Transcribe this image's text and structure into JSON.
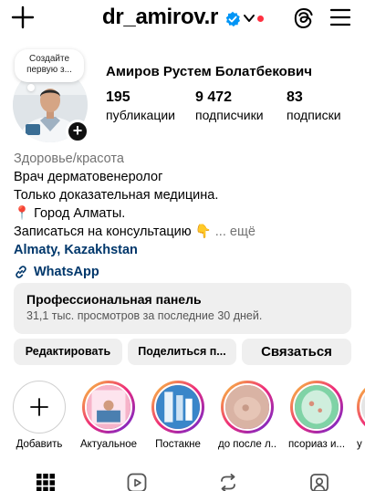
{
  "header": {
    "username": "dr_amirov.r",
    "has_unread_dot": true
  },
  "profile": {
    "note_line1": "Создайте",
    "note_line2": "первую з...",
    "full_name": "Амиров Рустем Болатбекович",
    "stats": [
      {
        "value": "195",
        "label": "публикации"
      },
      {
        "value": "9 472",
        "label": "подписчики"
      },
      {
        "value": "83",
        "label": "подписки"
      }
    ]
  },
  "bio": {
    "category": "Здоровье/красота",
    "lines": [
      "Врач дерматовенеролог",
      "Только доказательная медицина.",
      "📍 Город Алматы.",
      "Записаться на консультацию 👇"
    ],
    "more": "... ещё",
    "location": "Almaty, Kazakhstan",
    "link": "WhatsApp"
  },
  "professional_panel": {
    "title": "Профессиональная панель",
    "subtitle": "31,1 тыс. просмотров за последние 30 дней."
  },
  "buttons": {
    "edit": "Редактировать",
    "share": "Поделиться п...",
    "contact": "Связаться"
  },
  "highlights": [
    {
      "label": "Добавить",
      "icon": "plus-icon"
    },
    {
      "label": "Актуальное"
    },
    {
      "label": "Постакне"
    },
    {
      "label": "до после л..."
    },
    {
      "label": "псориаз и..."
    },
    {
      "label": "у"
    }
  ],
  "tabs": [
    {
      "icon": "grid-icon"
    },
    {
      "icon": "reels-icon"
    },
    {
      "icon": "reposts-icon"
    },
    {
      "icon": "tagged-icon"
    }
  ],
  "colors": {
    "accent_link": "#00376b",
    "verified_blue": "#0095f6",
    "button_bg": "#efefef",
    "notification_red": "#ff3040"
  }
}
